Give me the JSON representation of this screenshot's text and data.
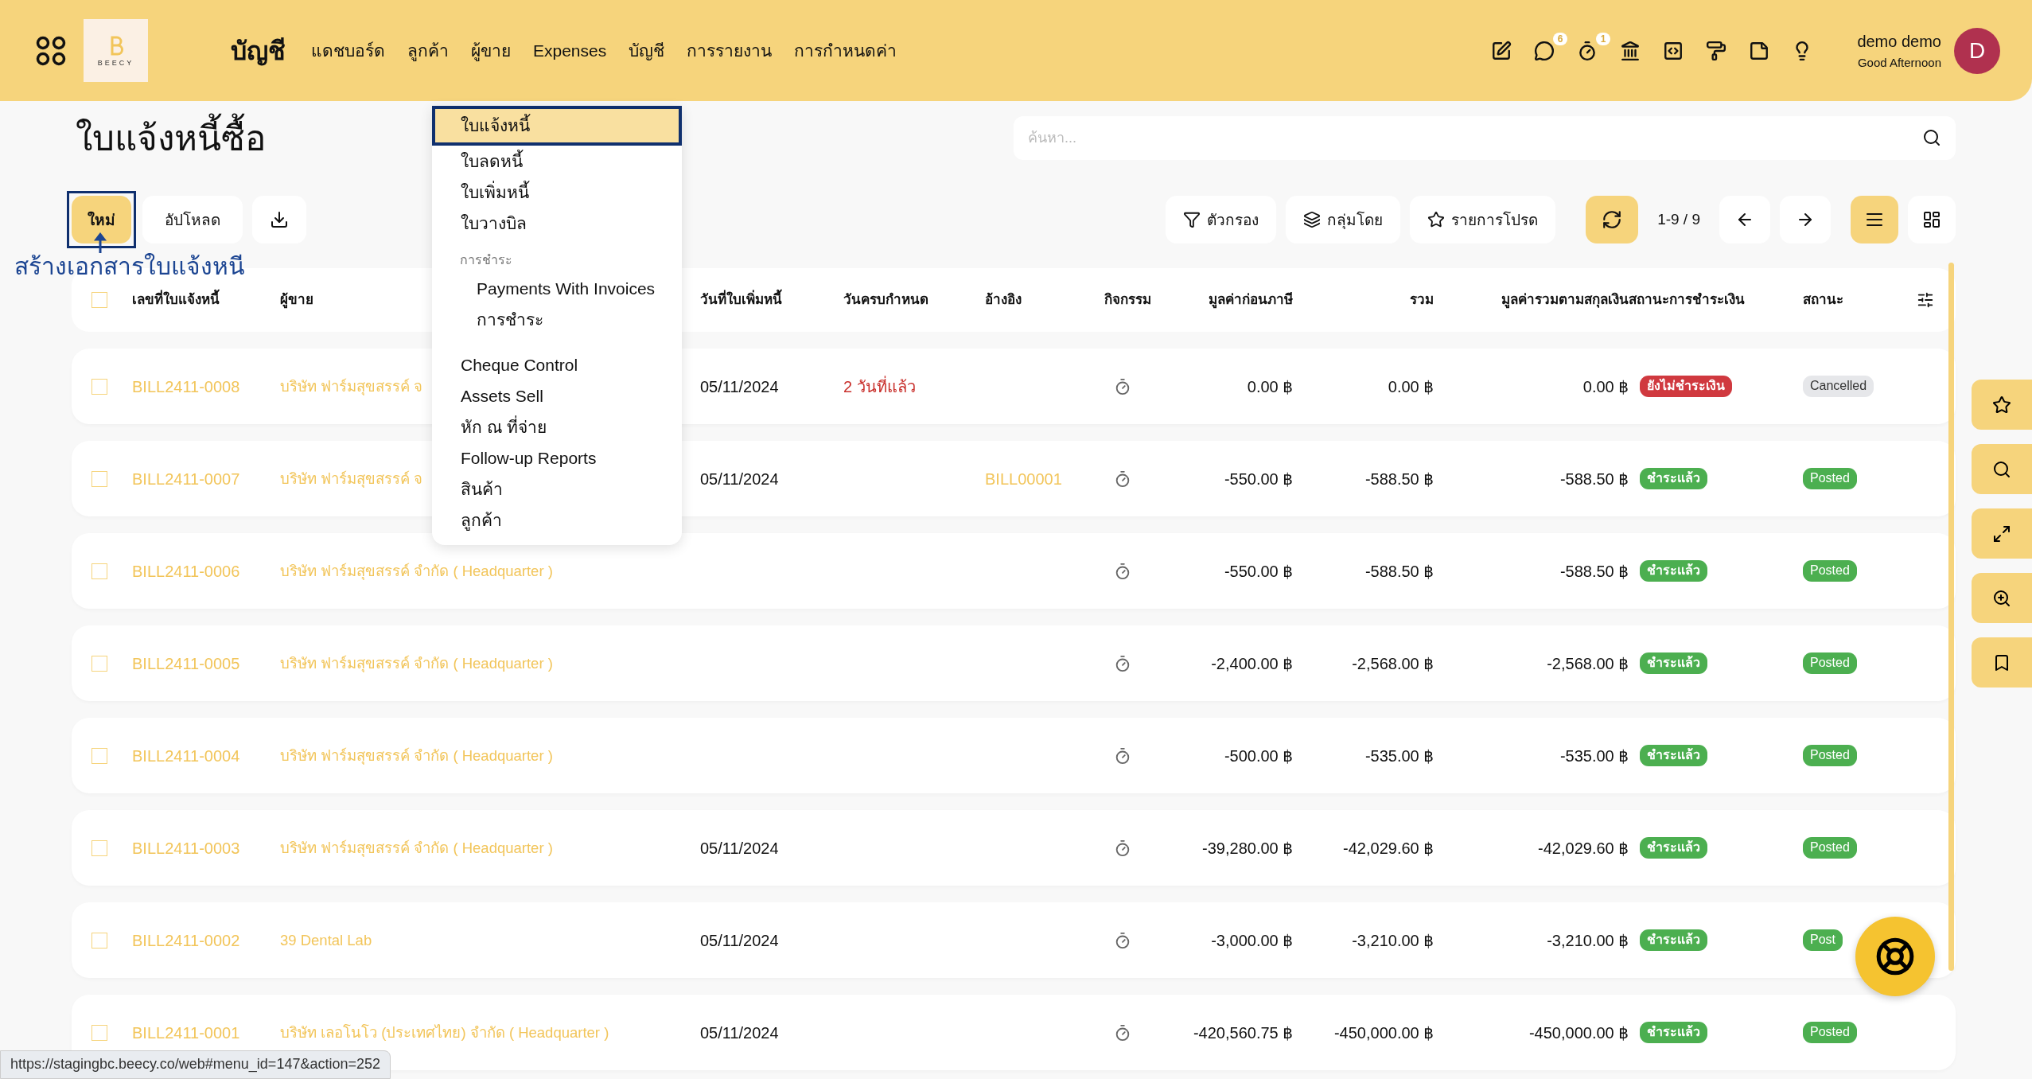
{
  "topbar": {
    "app_title": "บัญชี",
    "logo": "BEECY",
    "menu": [
      "แดชบอร์ด",
      "ลูกค้า",
      "ผู้ขาย",
      "Expenses",
      "บัญชี",
      "การรายงาน",
      "การกำหนดค่า"
    ],
    "icons": [
      {
        "kind": "edit"
      },
      {
        "kind": "chat",
        "badge": "6"
      },
      {
        "kind": "timer",
        "badge": "1"
      },
      {
        "kind": "building"
      },
      {
        "kind": "code"
      },
      {
        "kind": "paint"
      },
      {
        "kind": "note"
      },
      {
        "kind": "bulb"
      }
    ],
    "user": {
      "name": "demo demo",
      "greeting": "Good Afternoon",
      "initial": "D"
    }
  },
  "page_title": "ใบแจ้งหนี้ซื้อ",
  "search": {
    "placeholder": "ค้นหา..."
  },
  "actions": {
    "new": "ใหม่",
    "upload": "อัปโหลด"
  },
  "annotation": {
    "text": "สร้างเอกสารใบแจ้งหนี"
  },
  "tools": {
    "filter": "ตัวกรอง",
    "group": "กลุ่มโดย",
    "favorites": "รายการโปรด",
    "pager": "1-9 / 9",
    "views": [
      {
        "kind": "list",
        "selected": true
      },
      {
        "kind": "kanban",
        "selected": false
      }
    ]
  },
  "dropdown": [
    {
      "kind": "item",
      "label": "ใบแจ้งหนี้",
      "selected": true
    },
    {
      "kind": "item",
      "label": "ใบลดหนี้",
      "selected": false
    },
    {
      "kind": "item",
      "label": "ใบเพิ่มหนี้",
      "selected": false
    },
    {
      "kind": "item",
      "label": "ใบวางบิล",
      "selected": false
    },
    {
      "kind": "section",
      "label": "การชำระ"
    },
    {
      "kind": "subitem",
      "label": "Payments With Invoices",
      "selected": false
    },
    {
      "kind": "subitem",
      "label": "การชำระ",
      "selected": false
    },
    {
      "kind": "item",
      "label": "Cheque Control",
      "selected": false
    },
    {
      "kind": "item",
      "label": "Assets Sell",
      "selected": false
    },
    {
      "kind": "item",
      "label": "หัก ณ ที่จ่าย",
      "selected": false
    },
    {
      "kind": "item",
      "label": "Follow-up Reports",
      "selected": false
    },
    {
      "kind": "item",
      "label": "สินค้า",
      "selected": false
    },
    {
      "kind": "item",
      "label": "ลูกค้า",
      "selected": false
    }
  ],
  "table": {
    "checked": false,
    "columns": [
      "เลขที่ใบแจ้งหนี้",
      "ผู้ขาย",
      "วันที่ใบเพิ่มหนี้",
      "วันครบกำหนด",
      "อ้างอิง",
      "กิจกรรม",
      "มูลค่าก่อนภาษี",
      "รวม",
      "มูลค่ารวมตามสกุลเงิน",
      "สถานะการชำระเงิน",
      "สถานะ"
    ],
    "rows": [
      {
        "checked": false,
        "number": "BILL2411-0008",
        "vendor": "บริษัท ฟาร์มสุขสรรค์ จ",
        "date": "05/11/2024",
        "due": {
          "text": "2 วันที่แล้ว",
          "overdue": true
        },
        "pretax": "0.00 ฿",
        "total": "0.00 ฿",
        "currency_total": "0.00 ฿",
        "payment": {
          "kind": "unpaid",
          "text": "ยังไม่ชำระเงิน"
        },
        "status": {
          "kind": "cancelled",
          "text": "Cancelled"
        }
      },
      {
        "checked": false,
        "number": "BILL2411-0007",
        "vendor": "บริษัท ฟาร์มสุขสรรค์ จ",
        "date": "05/11/2024",
        "reference": "BILL00001",
        "pretax": "-550.00 ฿",
        "total": "-588.50 ฿",
        "currency_total": "-588.50 ฿",
        "payment": {
          "kind": "paid",
          "text": "ชำระแล้ว"
        },
        "status": {
          "kind": "posted",
          "text": "Posted"
        }
      },
      {
        "checked": false,
        "number": "BILL2411-0006",
        "vendor": "บริษัท ฟาร์มสุขสรรค์ จำกัด ( Headquarter )",
        "pretax": "-550.00 ฿",
        "total": "-588.50 ฿",
        "currency_total": "-588.50 ฿",
        "payment": {
          "kind": "paid",
          "text": "ชำระแล้ว"
        },
        "status": {
          "kind": "posted",
          "text": "Posted"
        }
      },
      {
        "checked": false,
        "number": "BILL2411-0005",
        "vendor": "บริษัท ฟาร์มสุขสรรค์ จำกัด ( Headquarter )",
        "pretax": "-2,400.00 ฿",
        "total": "-2,568.00 ฿",
        "currency_total": "-2,568.00 ฿",
        "payment": {
          "kind": "paid",
          "text": "ชำระแล้ว"
        },
        "status": {
          "kind": "posted",
          "text": "Posted"
        }
      },
      {
        "checked": false,
        "number": "BILL2411-0004",
        "vendor": "บริษัท ฟาร์มสุขสรรค์ จำกัด ( Headquarter )",
        "pretax": "-500.00 ฿",
        "total": "-535.00 ฿",
        "currency_total": "-535.00 ฿",
        "payment": {
          "kind": "paid",
          "text": "ชำระแล้ว"
        },
        "status": {
          "kind": "posted",
          "text": "Posted"
        }
      },
      {
        "checked": false,
        "number": "BILL2411-0003",
        "vendor": "บริษัท ฟาร์มสุขสรรค์ จำกัด ( Headquarter )",
        "date": "05/11/2024",
        "pretax": "-39,280.00 ฿",
        "total": "-42,029.60 ฿",
        "currency_total": "-42,029.60 ฿",
        "payment": {
          "kind": "paid",
          "text": "ชำระแล้ว"
        },
        "status": {
          "kind": "posted",
          "text": "Posted"
        }
      },
      {
        "checked": false,
        "number": "BILL2411-0002",
        "vendor": "39 Dental Lab",
        "date": "05/11/2024",
        "pretax": "-3,000.00 ฿",
        "total": "-3,210.00 ฿",
        "currency_total": "-3,210.00 ฿",
        "payment": {
          "kind": "paid",
          "text": "ชำระแล้ว"
        },
        "status": {
          "kind": "posted",
          "text": "Post"
        }
      },
      {
        "checked": false,
        "number": "BILL2411-0001",
        "vendor": "บริษัท เลอโนโว (ประเทศไทย) จำกัด ( Headquarter )",
        "date": "05/11/2024",
        "pretax": "-420,560.75 ฿",
        "total": "-450,000.00 ฿",
        "currency_total": "-450,000.00 ฿",
        "payment": {
          "kind": "paid",
          "text": "ชำระแล้ว"
        },
        "status": {
          "kind": "posted",
          "text": "Posted"
        }
      }
    ]
  },
  "side_buttons": [
    {
      "kind": "star"
    },
    {
      "kind": "search"
    },
    {
      "kind": "expand"
    },
    {
      "kind": "zoom"
    },
    {
      "kind": "bookmark"
    }
  ],
  "status_url": "https://stagingbc.beecy.co/web#menu_id=147&action=252"
}
